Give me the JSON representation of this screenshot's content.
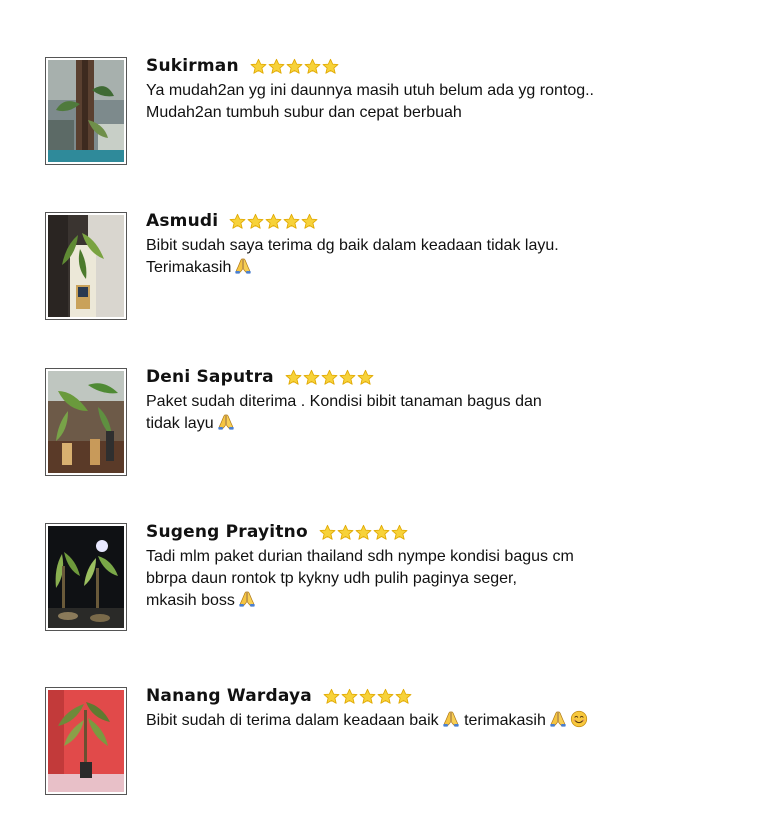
{
  "reviews": [
    {
      "name": "Sukirman",
      "rating": 5,
      "lines": [
        "Ya mudah2an yg ini daunnya masih utuh belum ada yg rontog..",
        "Mudah2an tumbuh subur dan cepat berbuah"
      ],
      "emoji_after_last_line": []
    },
    {
      "name": "Asmudi",
      "rating": 5,
      "lines": [
        "Bibit sudah saya terima dg baik dalam keadaan tidak layu.",
        "Terimakasih"
      ],
      "emoji_after_last_line": [
        "folded-hands-icon"
      ]
    },
    {
      "name": "Deni Saputra",
      "rating": 5,
      "lines": [
        "Paket sudah diterima . Kondisi bibit tanaman bagus dan",
        "tidak layu"
      ],
      "emoji_after_last_line": [
        "folded-hands-icon"
      ]
    },
    {
      "name": "Sugeng Prayitno",
      "rating": 5,
      "lines": [
        "Tadi mlm paket durian thailand sdh nympe kondisi bagus cm",
        "bbrpa daun rontok tp kykny udh pulih paginya seger,",
        "mkasih boss"
      ],
      "emoji_after_last_line": [
        "folded-hands-icon"
      ]
    },
    {
      "name": "Nanang Wardaya",
      "rating": 5,
      "line_parts": [
        "Bibit sudah di terima dalam keadaan baik",
        "terimakasih"
      ],
      "emoji_after_last_line": [
        "folded-hands-icon",
        "smiling-face-icon"
      ]
    }
  ],
  "colors": {
    "star_fill": "#f7d23a",
    "star_stroke": "#e0a800",
    "text": "#111111"
  }
}
